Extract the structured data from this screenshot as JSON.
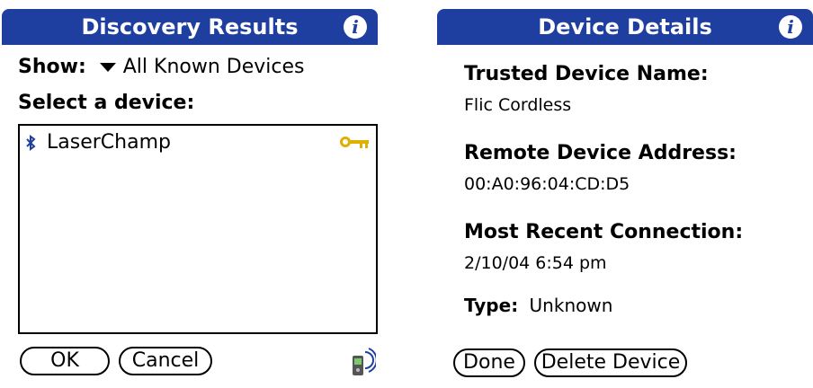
{
  "discovery": {
    "title": "Discovery Results",
    "show_label": "Show:",
    "show_value": "All Known Devices",
    "select_label": "Select a device:",
    "devices": [
      {
        "name": "LaserChamp",
        "icon": "bluetooth-icon",
        "trusted_icon": "key-icon"
      }
    ],
    "ok_label": "OK",
    "cancel_label": "Cancel"
  },
  "details": {
    "title": "Device Details",
    "trusted_name_label": "Trusted Device Name:",
    "trusted_name_value": "Flic Cordless",
    "address_label": "Remote Device Address:",
    "address_value": "00:A0:96:04:CD:D5",
    "recent_label": "Most Recent Connection:",
    "recent_value": "2/10/04 6:54 pm",
    "type_label": "Type:",
    "type_value": "Unknown",
    "done_label": "Done",
    "delete_label": "Delete Device"
  },
  "colors": {
    "titlebar": "#1f3fa0",
    "key": "#f2c200",
    "bluetooth": "#1f3fa0"
  }
}
